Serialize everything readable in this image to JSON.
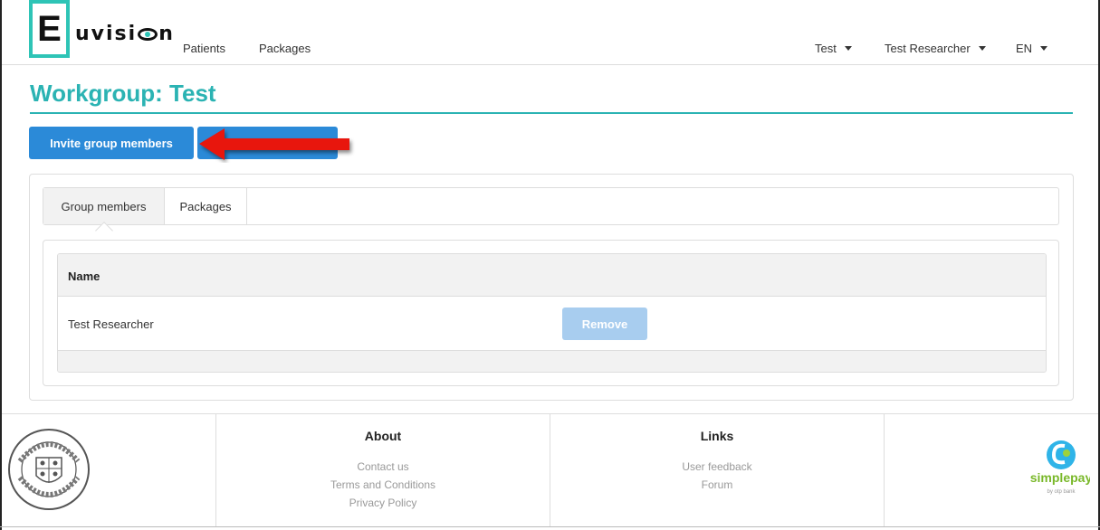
{
  "nav": {
    "logo_letter": "E",
    "logo_word_pre": "uvisi",
    "logo_word_post": "n",
    "links": [
      "Patients",
      "Packages"
    ],
    "workgroup_menu": "Test",
    "user_menu": "Test Researcher",
    "language_menu": "EN"
  },
  "page": {
    "title": "Workgroup: Test"
  },
  "actions": {
    "invite_label": "Invite group members",
    "second_label": ""
  },
  "tabs": [
    {
      "label": "Group members",
      "active": true
    },
    {
      "label": "Packages",
      "active": false
    }
  ],
  "members_table": {
    "columns": [
      "Name"
    ],
    "rows": [
      {
        "name": "Test Researcher",
        "action_label": "Remove"
      }
    ]
  },
  "footer": {
    "about": {
      "heading": "About",
      "links": [
        "Contact us",
        "Terms and Conditions",
        "Privacy Policy"
      ]
    },
    "links": {
      "heading": "Links",
      "links": [
        "User feedback",
        "Forum"
      ]
    },
    "seal_text": "UNIVERSITAS QUINQUEECCLESIENSIS 1367",
    "payment_logo": "simplepay",
    "payment_logo_sub": "by otp bank"
  },
  "colors": {
    "brand_teal": "#2bb3b3",
    "primary_blue": "#2b8ad8",
    "disabled_blue": "#a8cdef",
    "annotation_red": "#e8120c"
  },
  "icons": {
    "dropdown": "caret-down-icon",
    "annotation": "red-arrow-left-icon"
  }
}
